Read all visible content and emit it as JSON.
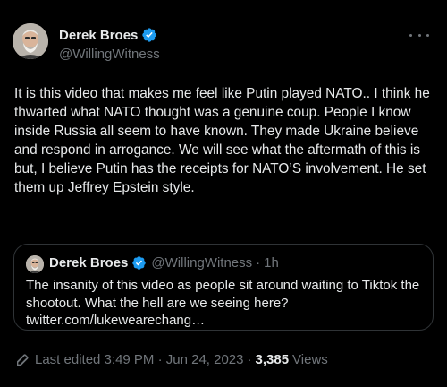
{
  "author": {
    "display_name": "Derek Broes",
    "handle": "@WillingWitness"
  },
  "tweet": {
    "text": "It is this video that makes me feel like Putin played NATO.. I think he thwarted what NATO thought was a genuine coup. People I know inside Russia all seem to have known.  They made Ukraine believe and respond in arrogance. We will see what the aftermath of this is but, I believe Putin has the receipts for NATO’S involvement. He set them up Jeffrey Epstein style."
  },
  "quote": {
    "display_name": "Derek Broes",
    "handle": "@WillingWitness",
    "separator": "·",
    "time": "1h",
    "text": "The insanity of this video as people sit around waiting to Tiktok the shootout. What the hell are we seeing here?",
    "link": "twitter.com/lukewearechang…"
  },
  "meta": {
    "edited_label": "Last edited 3:49 PM · Jun 24, 2023",
    "separator": "·",
    "views_count": "3,385",
    "views_label": "Views"
  },
  "icons": {
    "verified": "verified-badge-icon",
    "more": "more-options-icon",
    "edit": "pencil-icon"
  },
  "colors": {
    "background": "#000000",
    "text": "#e7e9ea",
    "secondary": "#71767b",
    "verified": "#1d9bf0",
    "border": "#2f3336"
  }
}
